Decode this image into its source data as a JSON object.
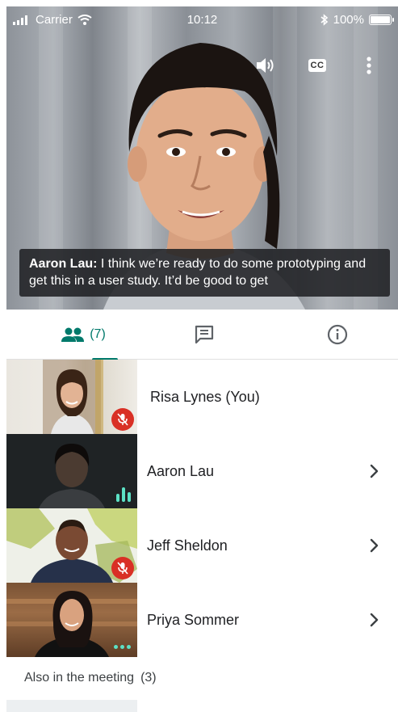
{
  "status_bar": {
    "carrier": "Carrier",
    "time": "10:12",
    "battery": "100%"
  },
  "video": {
    "controls": {
      "cc_label": "CC"
    },
    "caption": {
      "speaker": "Aaron Lau:",
      "text": " I think we’re ready to do some prototyping and get this in a user study. It’d be good to get"
    }
  },
  "tabs": {
    "people_count": "(7)"
  },
  "participants": [
    {
      "name": "Risa Lynes (You)",
      "status": "muted",
      "has_chevron": false
    },
    {
      "name": "Aaron Lau",
      "status": "speaking",
      "has_chevron": true
    },
    {
      "name": "Jeff Sheldon",
      "status": "muted",
      "has_chevron": true
    },
    {
      "name": "Priya Sommer",
      "status": "idle",
      "has_chevron": true
    }
  ],
  "also_in_meeting": {
    "label": "Also in the meeting",
    "count": "(3)"
  },
  "colors": {
    "accent": "#00796b",
    "mic_off": "#d93025",
    "speaking": "#5ce1c5"
  }
}
